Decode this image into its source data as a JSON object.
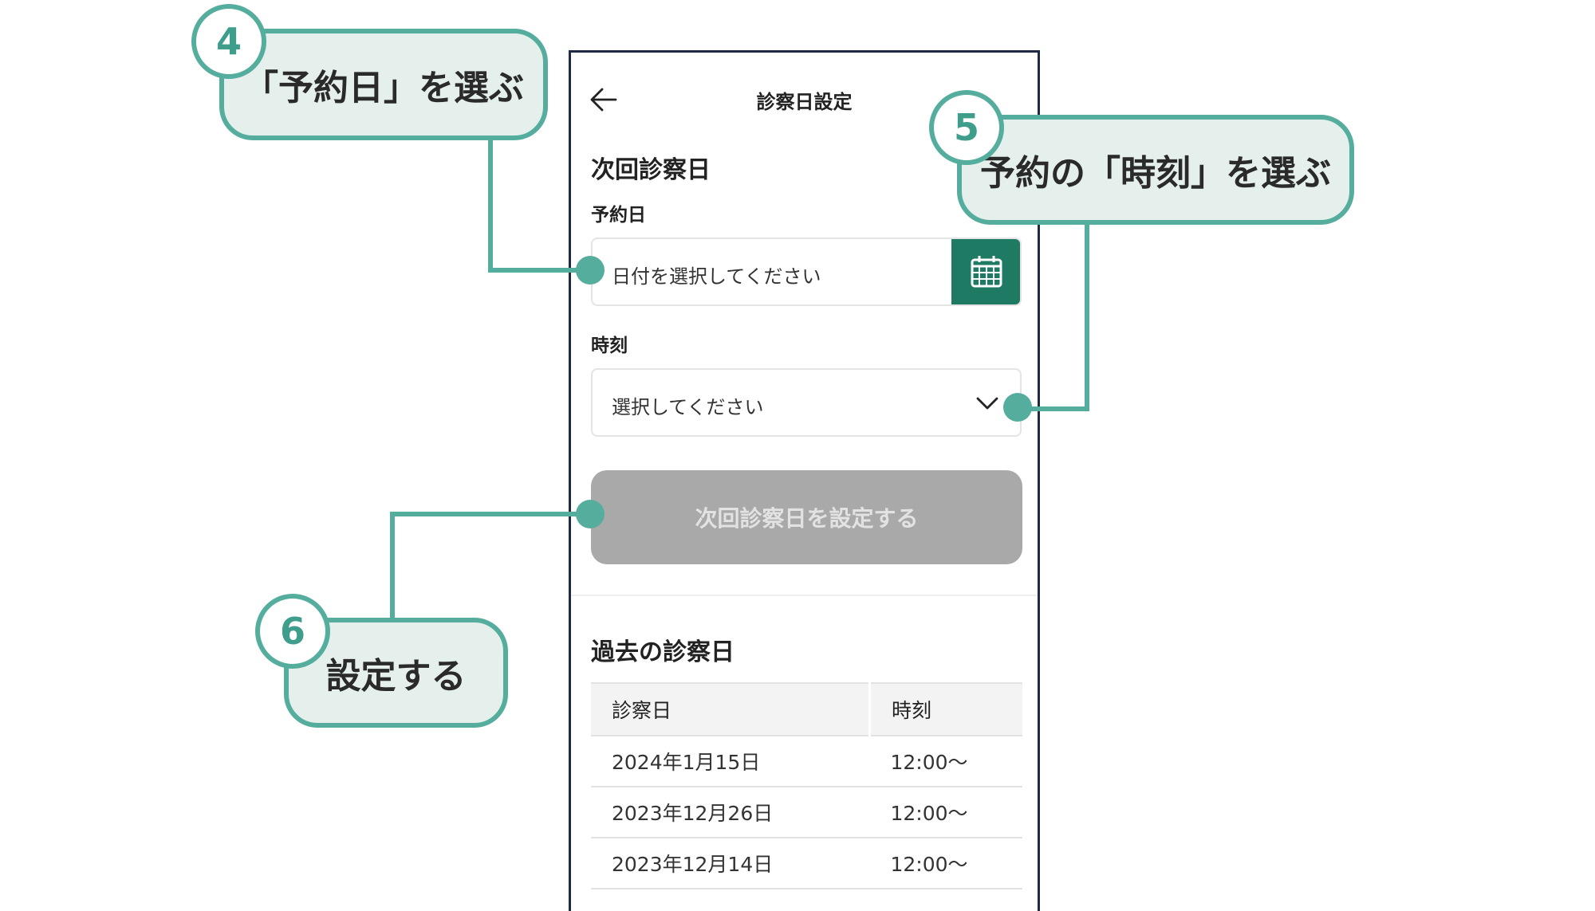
{
  "header": {
    "title": "診察日設定"
  },
  "next_visit": {
    "section_title": "次回診察日",
    "date_label": "予約日",
    "date_placeholder": "日付を選択してください",
    "time_label": "時刻",
    "time_placeholder": "選択してください",
    "submit_label": "次回診察日を設定する"
  },
  "past_visits": {
    "section_title": "過去の診察日",
    "columns": [
      "診察日",
      "時刻"
    ],
    "rows": [
      [
        "2024年1月15日",
        "12:00〜"
      ],
      [
        "2023年12月26日",
        "12:00〜"
      ],
      [
        "2023年12月14日",
        "12:00〜"
      ]
    ]
  },
  "callouts": [
    {
      "step": "4",
      "text": "「予約日」を選ぶ"
    },
    {
      "step": "5",
      "text": "予約の「時刻」を選ぶ"
    },
    {
      "step": "6",
      "text": "設定する"
    }
  ],
  "colors": {
    "accent": "#54ad9d",
    "callout_fill": "#e5efec",
    "calendar_button": "#1f7a63",
    "disabled_button": "#a9a9a9",
    "frame": "#1f2a44"
  },
  "icons": {
    "back": "arrow-left-icon",
    "calendar": "calendar-icon",
    "dropdown": "chevron-down-icon"
  }
}
